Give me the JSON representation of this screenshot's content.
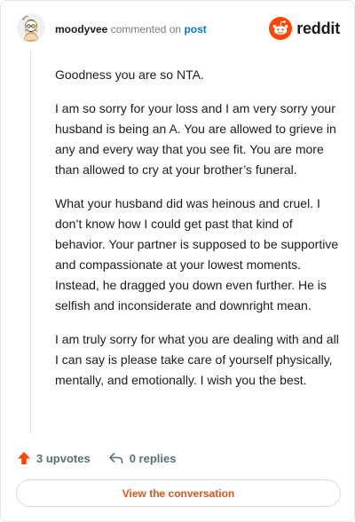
{
  "header": {
    "username": "moodyvee",
    "commented_text": "commented on",
    "post_link": "post",
    "brand": "reddit",
    "brand_color": "#ff4500"
  },
  "comment": {
    "paragraphs": [
      "Goodness you are so NTA.",
      "I am so sorry for your loss and I am very sorry your husband is being an A. You are allowed to grieve in any and every way that you see fit. You are more than allowed to cry at your brother’s funeral.",
      "What your husband did was heinous and cruel. I don’t know how I could get past that kind of behavior. Your partner is supposed to be supportive and compassionate at your lowest moments. Instead, he dragged you down even further. He is selfish and inconsiderate and downright mean.",
      "I am truly sorry for what you are dealing with and all I can say is please take care of yourself physically, mentally, and emotionally. I wish you the best."
    ]
  },
  "footer": {
    "upvotes": "3 upvotes",
    "replies": "0 replies",
    "view_button": "View the conversation",
    "upvote_icon": "upvote-arrow-icon",
    "reply_icon": "reply-arrow-icon",
    "upvote_color": "#ff4500",
    "button_text_color": "#e0551b"
  }
}
